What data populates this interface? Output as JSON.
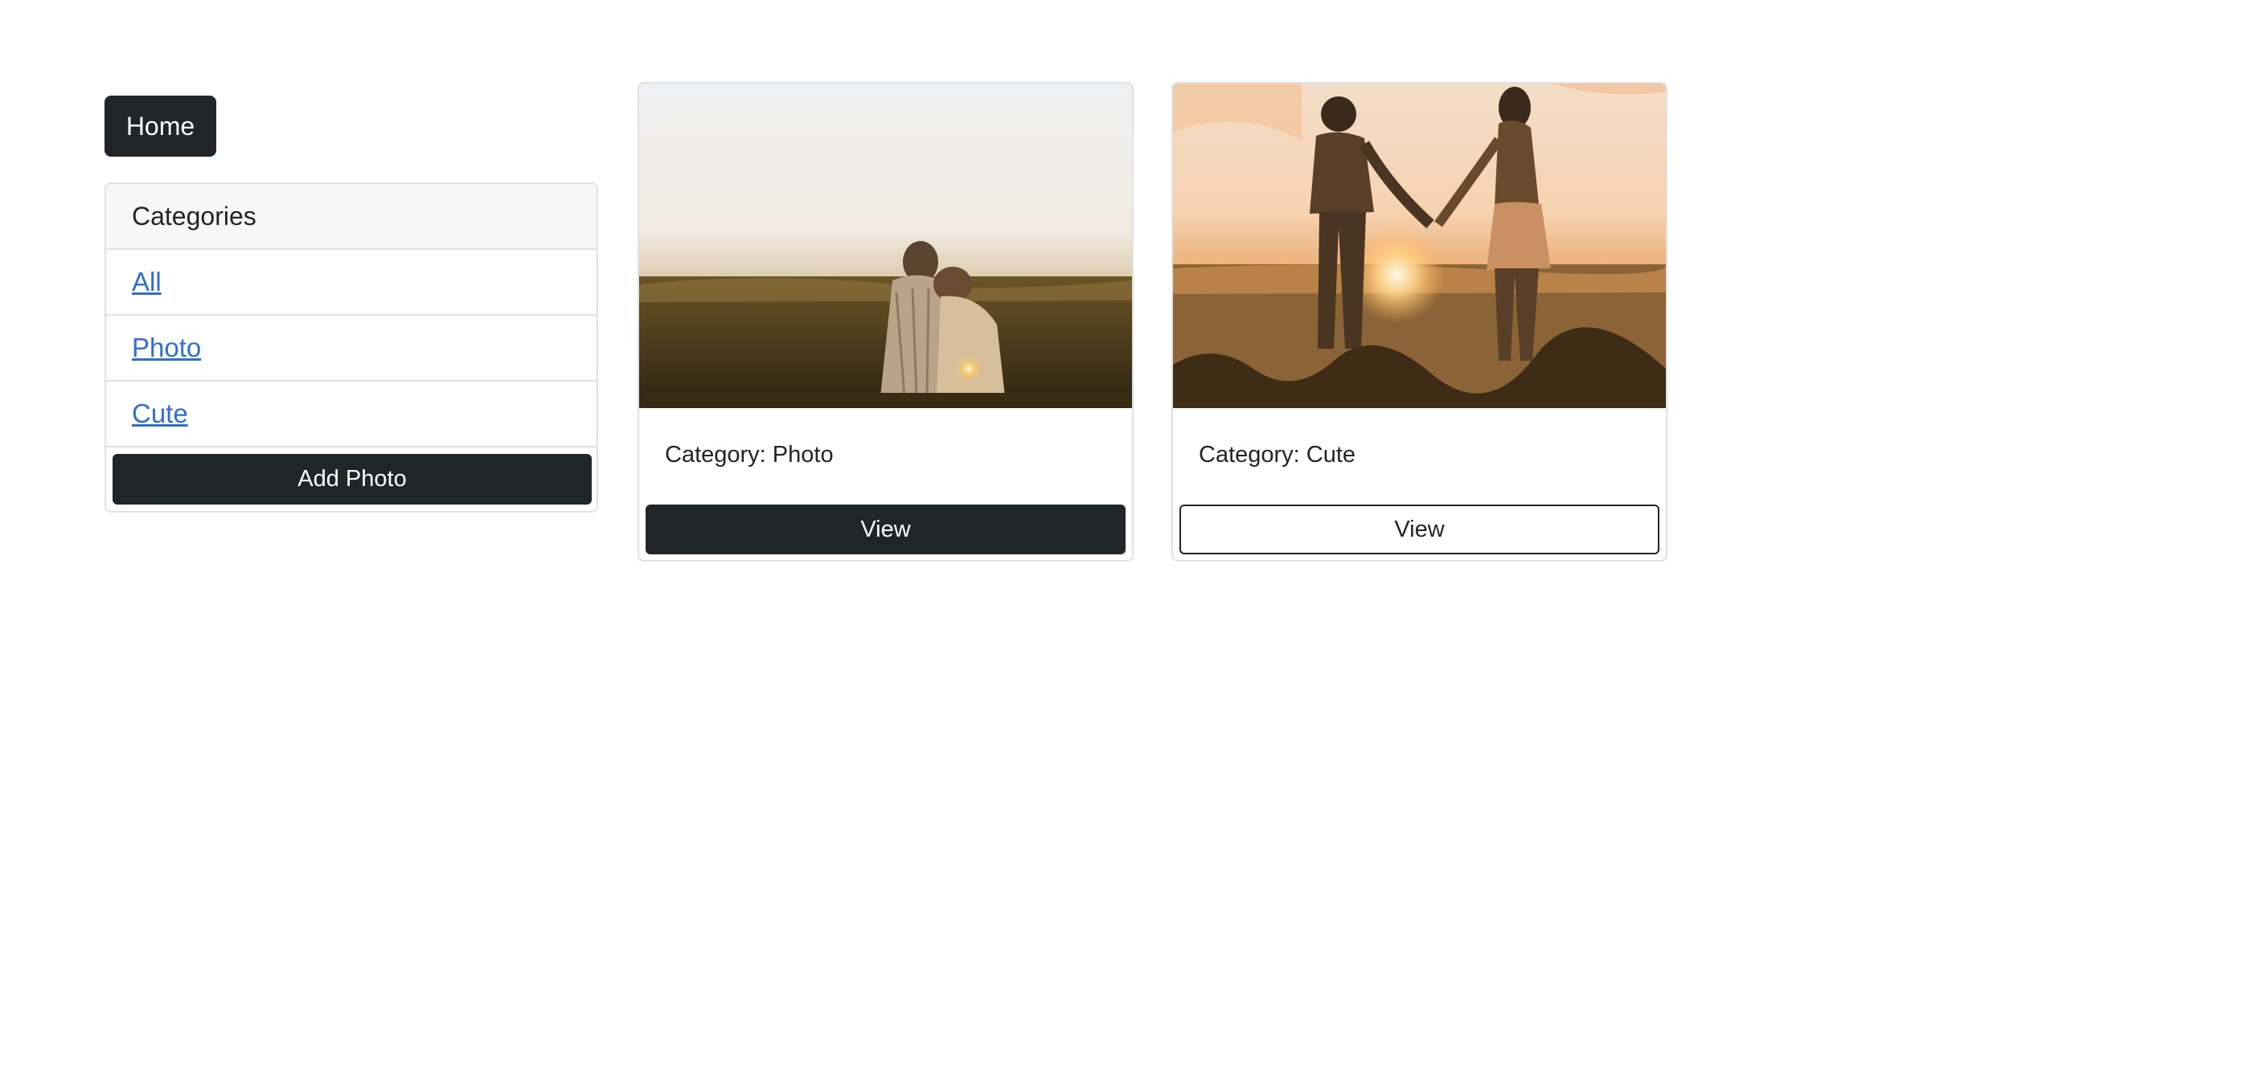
{
  "nav": {
    "home_label": "Home"
  },
  "categories": {
    "header": "Categories",
    "items": [
      {
        "label": "All"
      },
      {
        "label": "Photo"
      },
      {
        "label": "Cute"
      }
    ],
    "add_photo_label": "Add Photo"
  },
  "cards": [
    {
      "image_icon": "couple-sitting-sunset-photo",
      "category_text": "Category: Photo",
      "button_label": "View",
      "button_style": "dark"
    },
    {
      "image_icon": "couple-holding-hands-sunset-photo",
      "category_text": "Category: Cute",
      "button_label": "View",
      "button_style": "outline"
    }
  ],
  "colors": {
    "dark": "#212529",
    "link": "#2f6fd6",
    "border": "#dee2e6",
    "header_bg": "#f7f7f7"
  }
}
